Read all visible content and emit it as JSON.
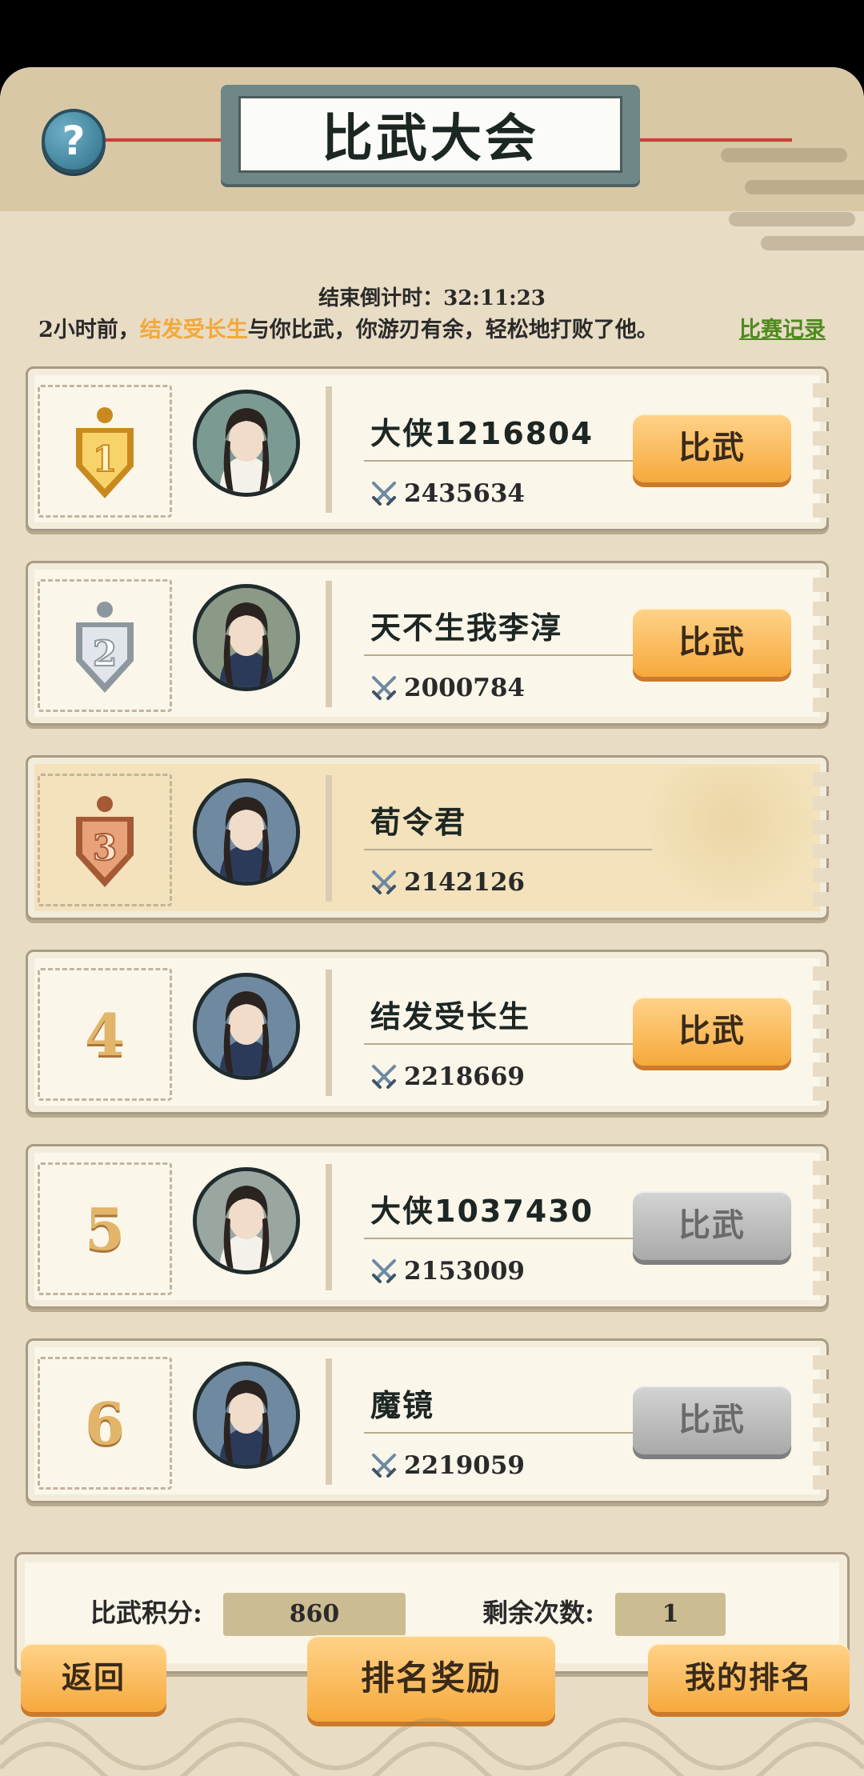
{
  "header": {
    "title": "比武大会",
    "help_label": "?"
  },
  "countdown": "结束倒计时：32:11:23",
  "notice": {
    "prefix": "2小时前，",
    "player": "结发受长生",
    "suffix": "与你比武，你游刃有余，轻松地打败了他。",
    "link": "比赛记录"
  },
  "rankings": [
    {
      "rank": "1",
      "name": "大侠1216804",
      "power": "2435634",
      "button": "比武",
      "button_state": "active",
      "medal": "gold",
      "self": false
    },
    {
      "rank": "2",
      "name": "天不生我李淳",
      "power": "2000784",
      "button": "比武",
      "button_state": "active",
      "medal": "silver",
      "self": false
    },
    {
      "rank": "3",
      "name": "荀令君",
      "power": "2142126",
      "button": "",
      "button_state": "none",
      "medal": "bronze",
      "self": true
    },
    {
      "rank": "4",
      "name": "结发受长生",
      "power": "2218669",
      "button": "比武",
      "button_state": "active",
      "medal": "",
      "self": false
    },
    {
      "rank": "5",
      "name": "大侠1037430",
      "power": "2153009",
      "button": "比武",
      "button_state": "disabled",
      "medal": "",
      "self": false
    },
    {
      "rank": "6",
      "name": "魔镜",
      "power": "2219059",
      "button": "比武",
      "button_state": "disabled",
      "medal": "",
      "self": false
    }
  ],
  "stats": {
    "score_label": "比武积分:",
    "score_value": "860",
    "remaining_label": "剩余次数:",
    "remaining_value": "1"
  },
  "footer": {
    "back": "返回",
    "rewards": "排名奖励",
    "my_rank": "我的排名"
  },
  "colors": {
    "accent_orange": "#f6a93c",
    "highlight_name": "#f2a93b",
    "link_green": "#4e8a1e"
  }
}
